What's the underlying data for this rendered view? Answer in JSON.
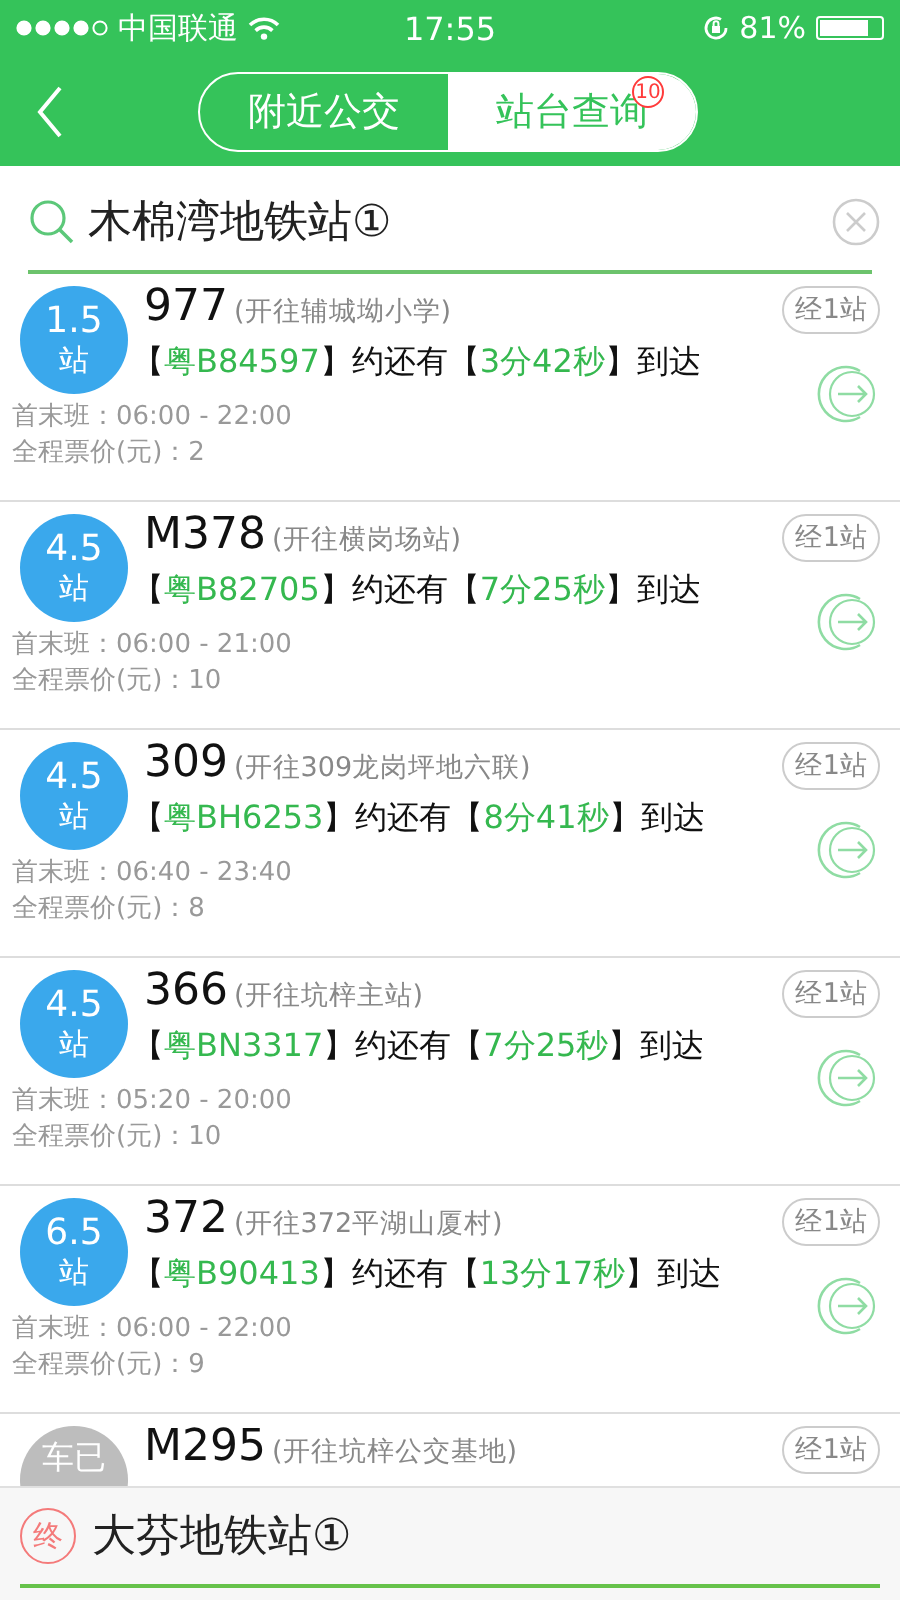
{
  "status_bar": {
    "carrier": "中国联通",
    "time": "17:55",
    "battery": "81%",
    "level": 0.81
  },
  "header": {
    "tabs": [
      {
        "label": "附近公交",
        "selected": false
      },
      {
        "label": "站台查询",
        "selected": true,
        "badge": "10"
      }
    ]
  },
  "search": {
    "value": "木棉湾地铁站①"
  },
  "routes": [
    {
      "badge": {
        "kind": "distance",
        "value": "1.5",
        "unit": "站"
      },
      "route": "977",
      "destination": "(开往辅城坳小学)",
      "stops": "经1站",
      "arrival": [
        {
          "kind": "plain",
          "text": "【"
        },
        {
          "kind": "highlight",
          "text": "粤B84597"
        },
        {
          "kind": "plain",
          "text": "】约还有【"
        },
        {
          "kind": "highlight",
          "text": "3分42秒"
        },
        {
          "kind": "plain",
          "text": "】到达"
        }
      ],
      "schedule": "首末班：06:00 - 22:00",
      "fare": "全程票价(元)：2"
    },
    {
      "badge": {
        "kind": "distance",
        "value": "4.5",
        "unit": "站"
      },
      "route": "M378",
      "destination": "(开往横岗场站)",
      "stops": "经1站",
      "arrival": [
        {
          "kind": "plain",
          "text": "【"
        },
        {
          "kind": "highlight",
          "text": "粤B82705"
        },
        {
          "kind": "plain",
          "text": "】约还有【"
        },
        {
          "kind": "highlight",
          "text": "7分25秒"
        },
        {
          "kind": "plain",
          "text": "】到达"
        }
      ],
      "schedule": "首末班：06:00 - 21:00",
      "fare": "全程票价(元)：10"
    },
    {
      "badge": {
        "kind": "distance",
        "value": "4.5",
        "unit": "站"
      },
      "route": "309",
      "destination": "(开往309龙岗坪地六联)",
      "stops": "经1站",
      "arrival": [
        {
          "kind": "plain",
          "text": "【"
        },
        {
          "kind": "highlight",
          "text": "粤BH6253"
        },
        {
          "kind": "plain",
          "text": "】约还有【"
        },
        {
          "kind": "highlight",
          "text": "8分41秒"
        },
        {
          "kind": "plain",
          "text": "】到达"
        }
      ],
      "schedule": "首末班：06:40 - 23:40",
      "fare": "全程票价(元)：8"
    },
    {
      "badge": {
        "kind": "distance",
        "value": "4.5",
        "unit": "站"
      },
      "route": "366",
      "destination": "(开往坑梓主站)",
      "stops": "经1站",
      "arrival": [
        {
          "kind": "plain",
          "text": "【"
        },
        {
          "kind": "highlight",
          "text": "粤BN3317"
        },
        {
          "kind": "plain",
          "text": "】约还有【"
        },
        {
          "kind": "highlight",
          "text": "7分25秒"
        },
        {
          "kind": "plain",
          "text": "】到达"
        }
      ],
      "schedule": "首末班：05:20 - 20:00",
      "fare": "全程票价(元)：10"
    },
    {
      "badge": {
        "kind": "distance",
        "value": "6.5",
        "unit": "站"
      },
      "route": "372",
      "destination": "(开往372平湖山厦村)",
      "stops": "经1站",
      "arrival": [
        {
          "kind": "plain",
          "text": "【"
        },
        {
          "kind": "highlight",
          "text": "粤B90413"
        },
        {
          "kind": "plain",
          "text": "】约还有【"
        },
        {
          "kind": "highlight",
          "text": "13分17秒"
        },
        {
          "kind": "plain",
          "text": "】到达"
        }
      ],
      "schedule": "首末班：06:00 - 22:00",
      "fare": "全程票价(元)：9"
    },
    {
      "badge": {
        "kind": "arrived",
        "value": "车已"
      },
      "route": "M295",
      "destination": "(开往坑梓公交基地)",
      "stops": "经1站"
    }
  ],
  "destination_bar": {
    "icon_text": "终",
    "station": "大芬地铁站①"
  }
}
